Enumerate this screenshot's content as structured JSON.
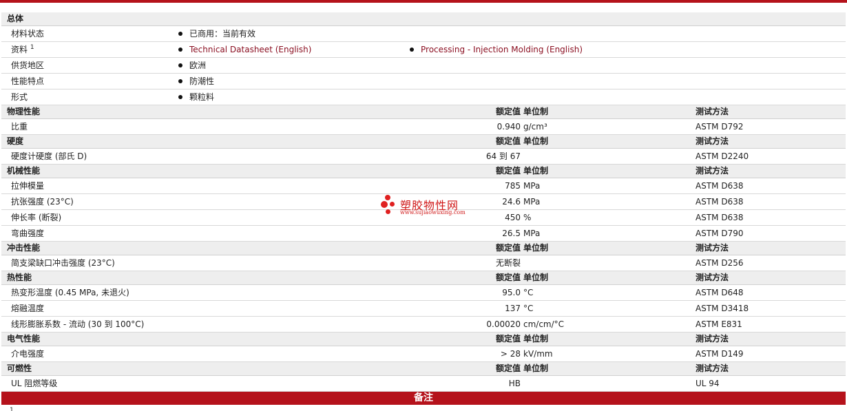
{
  "general": {
    "title": "总体",
    "rows": [
      {
        "label": "材料状态",
        "sup": "",
        "items": [
          {
            "text": "已商用：当前有效",
            "link": false
          }
        ]
      },
      {
        "label": "资料",
        "sup": "1",
        "items": [
          {
            "text": "Technical Datasheet (English)",
            "link": true
          },
          {
            "text": "Processing - Injection Molding (English)",
            "link": true
          }
        ]
      },
      {
        "label": "供货地区",
        "sup": "",
        "items": [
          {
            "text": "欧洲",
            "link": false
          }
        ]
      },
      {
        "label": "性能特点",
        "sup": "",
        "items": [
          {
            "text": "防潮性",
            "link": false
          }
        ]
      },
      {
        "label": "形式",
        "sup": "",
        "items": [
          {
            "text": "颗粒料",
            "link": false
          }
        ]
      }
    ]
  },
  "columns": {
    "value": "额定值",
    "unit": "单位制",
    "method": "测试方法"
  },
  "sections": [
    {
      "title": "物理性能",
      "rows": [
        {
          "label": "比重",
          "value": "0.940",
          "unit": "g/cm³",
          "method": "ASTM D792"
        }
      ]
    },
    {
      "title": "硬度",
      "rows": [
        {
          "label": "硬度计硬度 (部氏 D)",
          "value": "64 到  67",
          "unit": "",
          "method": "ASTM D2240"
        }
      ]
    },
    {
      "title": "机械性能",
      "rows": [
        {
          "label": "拉伸模量",
          "value": "785",
          "unit": "MPa",
          "method": "ASTM D638"
        },
        {
          "label": "抗张强度 (23°C)",
          "value": "24.6",
          "unit": "MPa",
          "method": "ASTM D638"
        },
        {
          "label": "伸长率 (断裂)",
          "value": "450",
          "unit": "%",
          "method": "ASTM D638"
        },
        {
          "label": "弯曲强度",
          "value": "26.5",
          "unit": "MPa",
          "method": "ASTM D790"
        }
      ]
    },
    {
      "title": "冲击性能",
      "rows": [
        {
          "label": "简支梁缺口冲击强度 (23°C)",
          "value": "无断裂",
          "unit": "",
          "method": "ASTM D256"
        }
      ]
    },
    {
      "title": "热性能",
      "rows": [
        {
          "label": "热变形温度 (0.45 MPa, 未退火)",
          "value": "95.0",
          "unit": "°C",
          "method": "ASTM D648"
        },
        {
          "label": "熔融温度",
          "value": "137",
          "unit": "°C",
          "method": "ASTM D3418"
        },
        {
          "label": "线形膨胀系数 - 流动 (30 到  100°C)",
          "value": "0.00020",
          "unit": "cm/cm/°C",
          "method": "ASTM E831"
        }
      ]
    },
    {
      "title": "电气性能",
      "rows": [
        {
          "label": "介电强度",
          "value": "> 28",
          "unit": "kV/mm",
          "method": "ASTM D149"
        }
      ]
    },
    {
      "title": "可燃性",
      "rows": [
        {
          "label": "UL 阻燃等级",
          "value": "HB",
          "unit": "",
          "method": "UL 94"
        }
      ]
    }
  ],
  "notes": {
    "title": "备注",
    "first_number": "1"
  },
  "watermark": {
    "title": "塑胶物性网",
    "url": "www.sujiaowuxing.com"
  },
  "colors": {
    "brand": "#b5121b",
    "link": "#8b1022",
    "section_bg": "#eeeeee"
  }
}
